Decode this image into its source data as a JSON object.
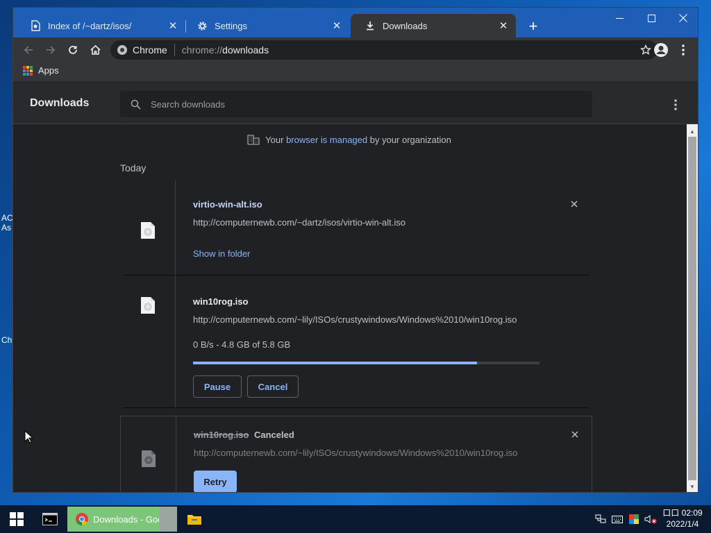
{
  "desktop": {
    "label1": "AC",
    "label2": "As",
    "label3": "Ch"
  },
  "tabs": [
    {
      "title": "Index of /~dartz/isos/",
      "icon": "page-icon"
    },
    {
      "title": "Settings",
      "icon": "gear-icon"
    },
    {
      "title": "Downloads",
      "icon": "download-icon",
      "active": true
    }
  ],
  "omnibox": {
    "chip": "Chrome",
    "scheme": "chrome://",
    "path": "downloads"
  },
  "bookmarks": {
    "apps": "Apps"
  },
  "page": {
    "title": "Downloads",
    "search_placeholder": "Search downloads",
    "managed_prefix": "Your",
    "managed_link": "browser is managed",
    "managed_suffix": "by your organization",
    "section": "Today"
  },
  "downloads": [
    {
      "name": "virtio-win-alt.iso",
      "url": "http://computernewb.com/~dartz/isos/virtio-win-alt.iso",
      "action": "Show in folder"
    },
    {
      "name": "win10rog.iso",
      "url": "http://computernewb.com/~lily/ISOs/crustywindows/Windows%2010/win10rog.iso",
      "status": "0 B/s - 4.8 GB of 5.8 GB",
      "progress": 0.82,
      "pause": "Pause",
      "cancel": "Cancel"
    },
    {
      "name": "win10rog.iso",
      "state": "Canceled",
      "url": "http://computernewb.com/~lily/ISOs/crustywindows/Windows%2010/win10rog.iso",
      "retry": "Retry"
    }
  ],
  "taskbar": {
    "chrome_title": "Downloads - Googl...",
    "time": "02:09",
    "date": "2022/1/4",
    "ime": "口口"
  },
  "colors": {
    "accent": "#8ab4f8",
    "titlebar": "#1f5eb6",
    "page_bg": "#202124"
  }
}
